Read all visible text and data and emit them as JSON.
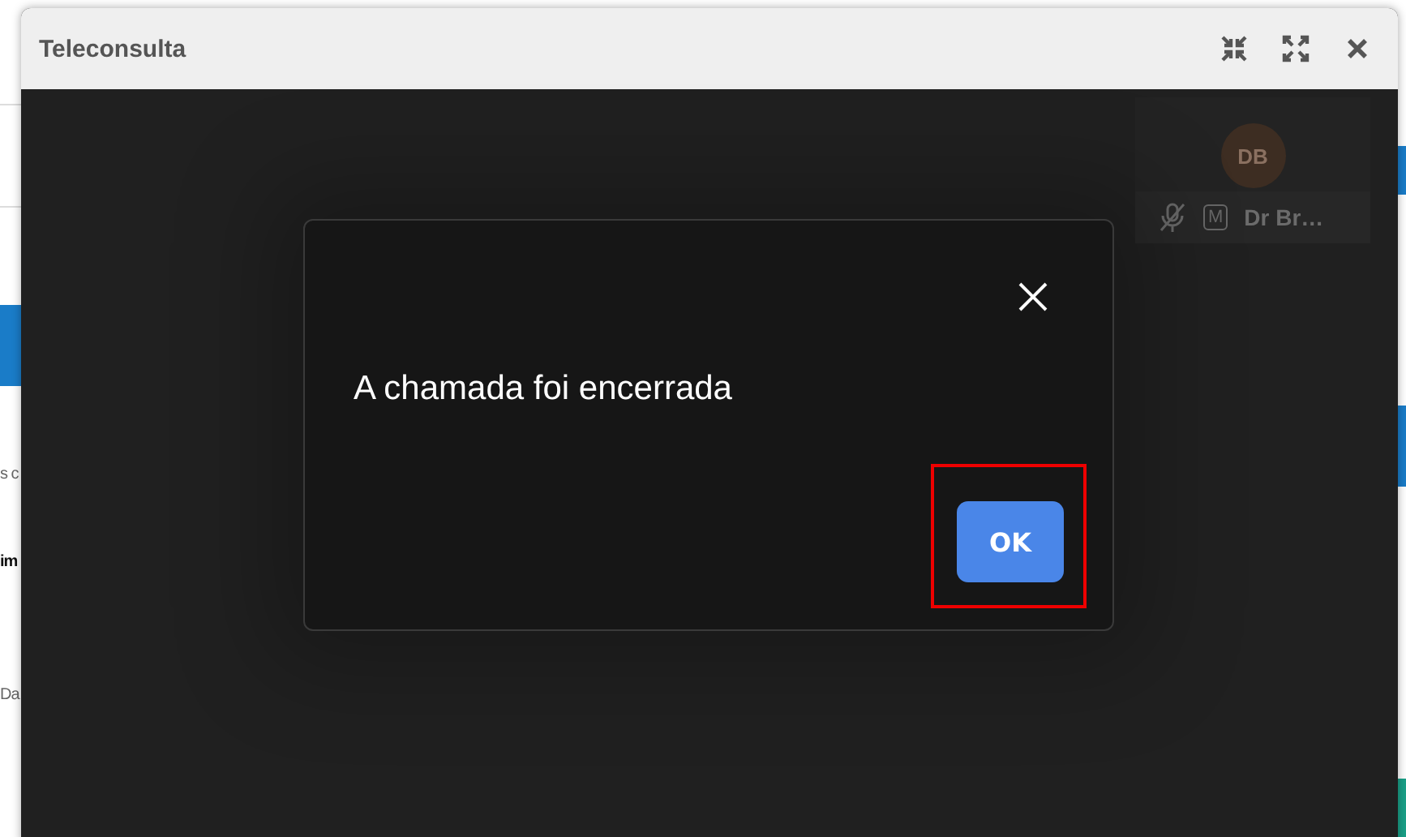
{
  "background_page": {
    "fragments": [
      "s c",
      "im",
      "Da"
    ]
  },
  "window": {
    "title": "Teleconsulta",
    "controls": [
      {
        "kind": "restore"
      },
      {
        "kind": "fullscreen"
      },
      {
        "kind": "close"
      }
    ]
  },
  "participant": {
    "initials": "DB",
    "muted": true,
    "badge": "M",
    "name": "Dr Br…"
  },
  "dialog": {
    "message": "A chamada foi encerrada",
    "button": "OK",
    "button_highlighted": true
  }
}
